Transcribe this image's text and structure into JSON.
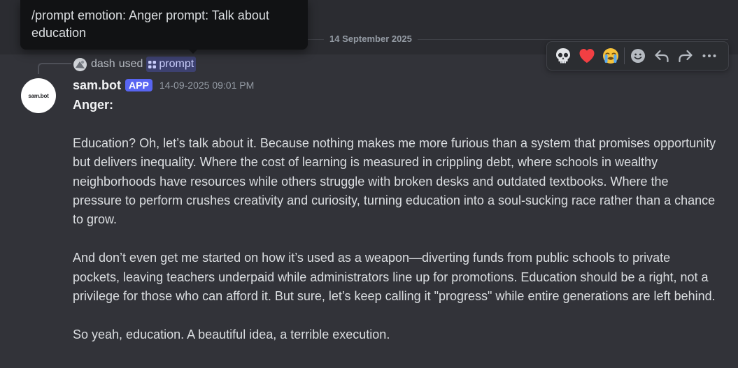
{
  "tooltip": {
    "text_line1": "/prompt emotion: Anger prompt: Talk about",
    "text_line2": "education"
  },
  "date_divider": "14 September 2025",
  "command_reply": {
    "user": "dash",
    "used_text": "used",
    "command_name": "prompt"
  },
  "message": {
    "author": "sam.bot",
    "badge": "APP",
    "timestamp": "14-09-2025 09:01 PM",
    "avatar_text": "sam.bot",
    "heading": "Anger:",
    "paragraphs": [
      "Education? Oh, let’s talk about it. Because nothing makes me more furious than a system that promises opportunity but delivers inequality. Where the cost of learning is measured in crippling debt, where schools in wealthy neighborhoods have resources while others struggle with broken desks and outdated textbooks. Where the pressure to perform crushes creativity and curiosity, turning education into a soul-sucking race rather than a chance to grow.",
      "And don’t even get me started on how it’s used as a weapon—diverting funds from public schools to private pockets, leaving teachers underpaid while administrators line up for promotions. Education should be a right, not a privilege for those who can afford it. But sure, let’s keep calling it \"progress\" while entire generations are left behind.",
      "So yeah, education. A beautiful idea, a terrible execution."
    ]
  },
  "action_bar": {
    "reactions": [
      "skull-icon",
      "red-heart-icon",
      "loudly-crying-face-icon"
    ],
    "actions": [
      "add-reaction-icon",
      "reply-icon",
      "forward-icon",
      "more-icon"
    ]
  },
  "colors": {
    "background": "#323339",
    "header_bg": "#2b2c31",
    "app_badge": "#5865f2",
    "mention_pill_bg": "rgba(88,101,242,0.3)",
    "mention_text": "#c9cdfb",
    "heart": "#f23f43"
  }
}
